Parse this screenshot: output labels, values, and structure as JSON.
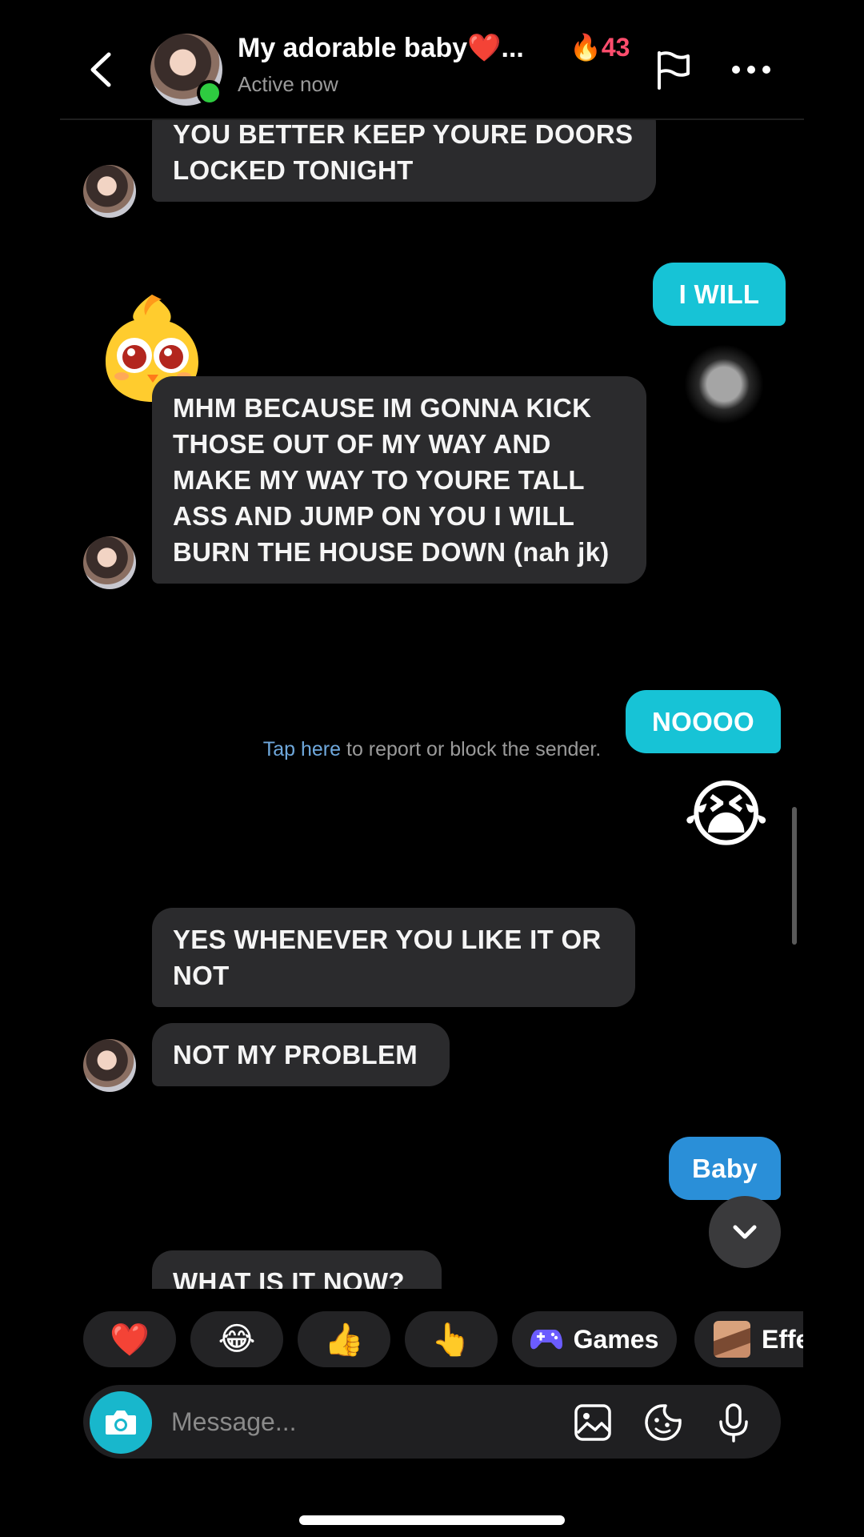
{
  "header": {
    "name": "My adorable baby❤️...",
    "streak": "🔥43",
    "status": "Active now"
  },
  "messages": {
    "m1": "YOU BETTER KEEP YOURE DOORS LOCKED TONIGHT",
    "m2": "I WILL",
    "m3": "MHM BECAUSE IM GONNA KICK THOSE OUT OF MY WAY AND MAKE MY WAY TO YOURE TALL ASS AND JUMP ON YOU I WILL BURN THE HOUSE DOWN (nah jk)",
    "report_link": "Tap here",
    "report_rest": " to report or block the sender.",
    "m4": "NOOOO",
    "m5_emoji": "😭",
    "m6": "YES WHENEVER YOU LIKE IT OR NOT",
    "m7": "NOT MY PROBLEM",
    "m8": "Baby",
    "m9": "WHAT IS IT NOW?"
  },
  "reactions": {
    "r1": "❤️",
    "r2": "😂",
    "r3": "👍",
    "r4": "👆",
    "games": "Games",
    "effects": "Effe"
  },
  "composer": {
    "placeholder": "Message..."
  },
  "colors": {
    "sent_bubble": "#17c3d6",
    "sent_bubble_alt": "#2a8fd8",
    "received_bubble": "#2b2b2d",
    "streak": "#ff4d6d",
    "online": "#2ecc40"
  },
  "icons": [
    "back-arrow-icon",
    "flag-icon",
    "more-icon",
    "chevron-down-icon",
    "camera-icon",
    "gallery-icon",
    "sticker-icon",
    "microphone-icon",
    "games-controller-icon"
  ]
}
